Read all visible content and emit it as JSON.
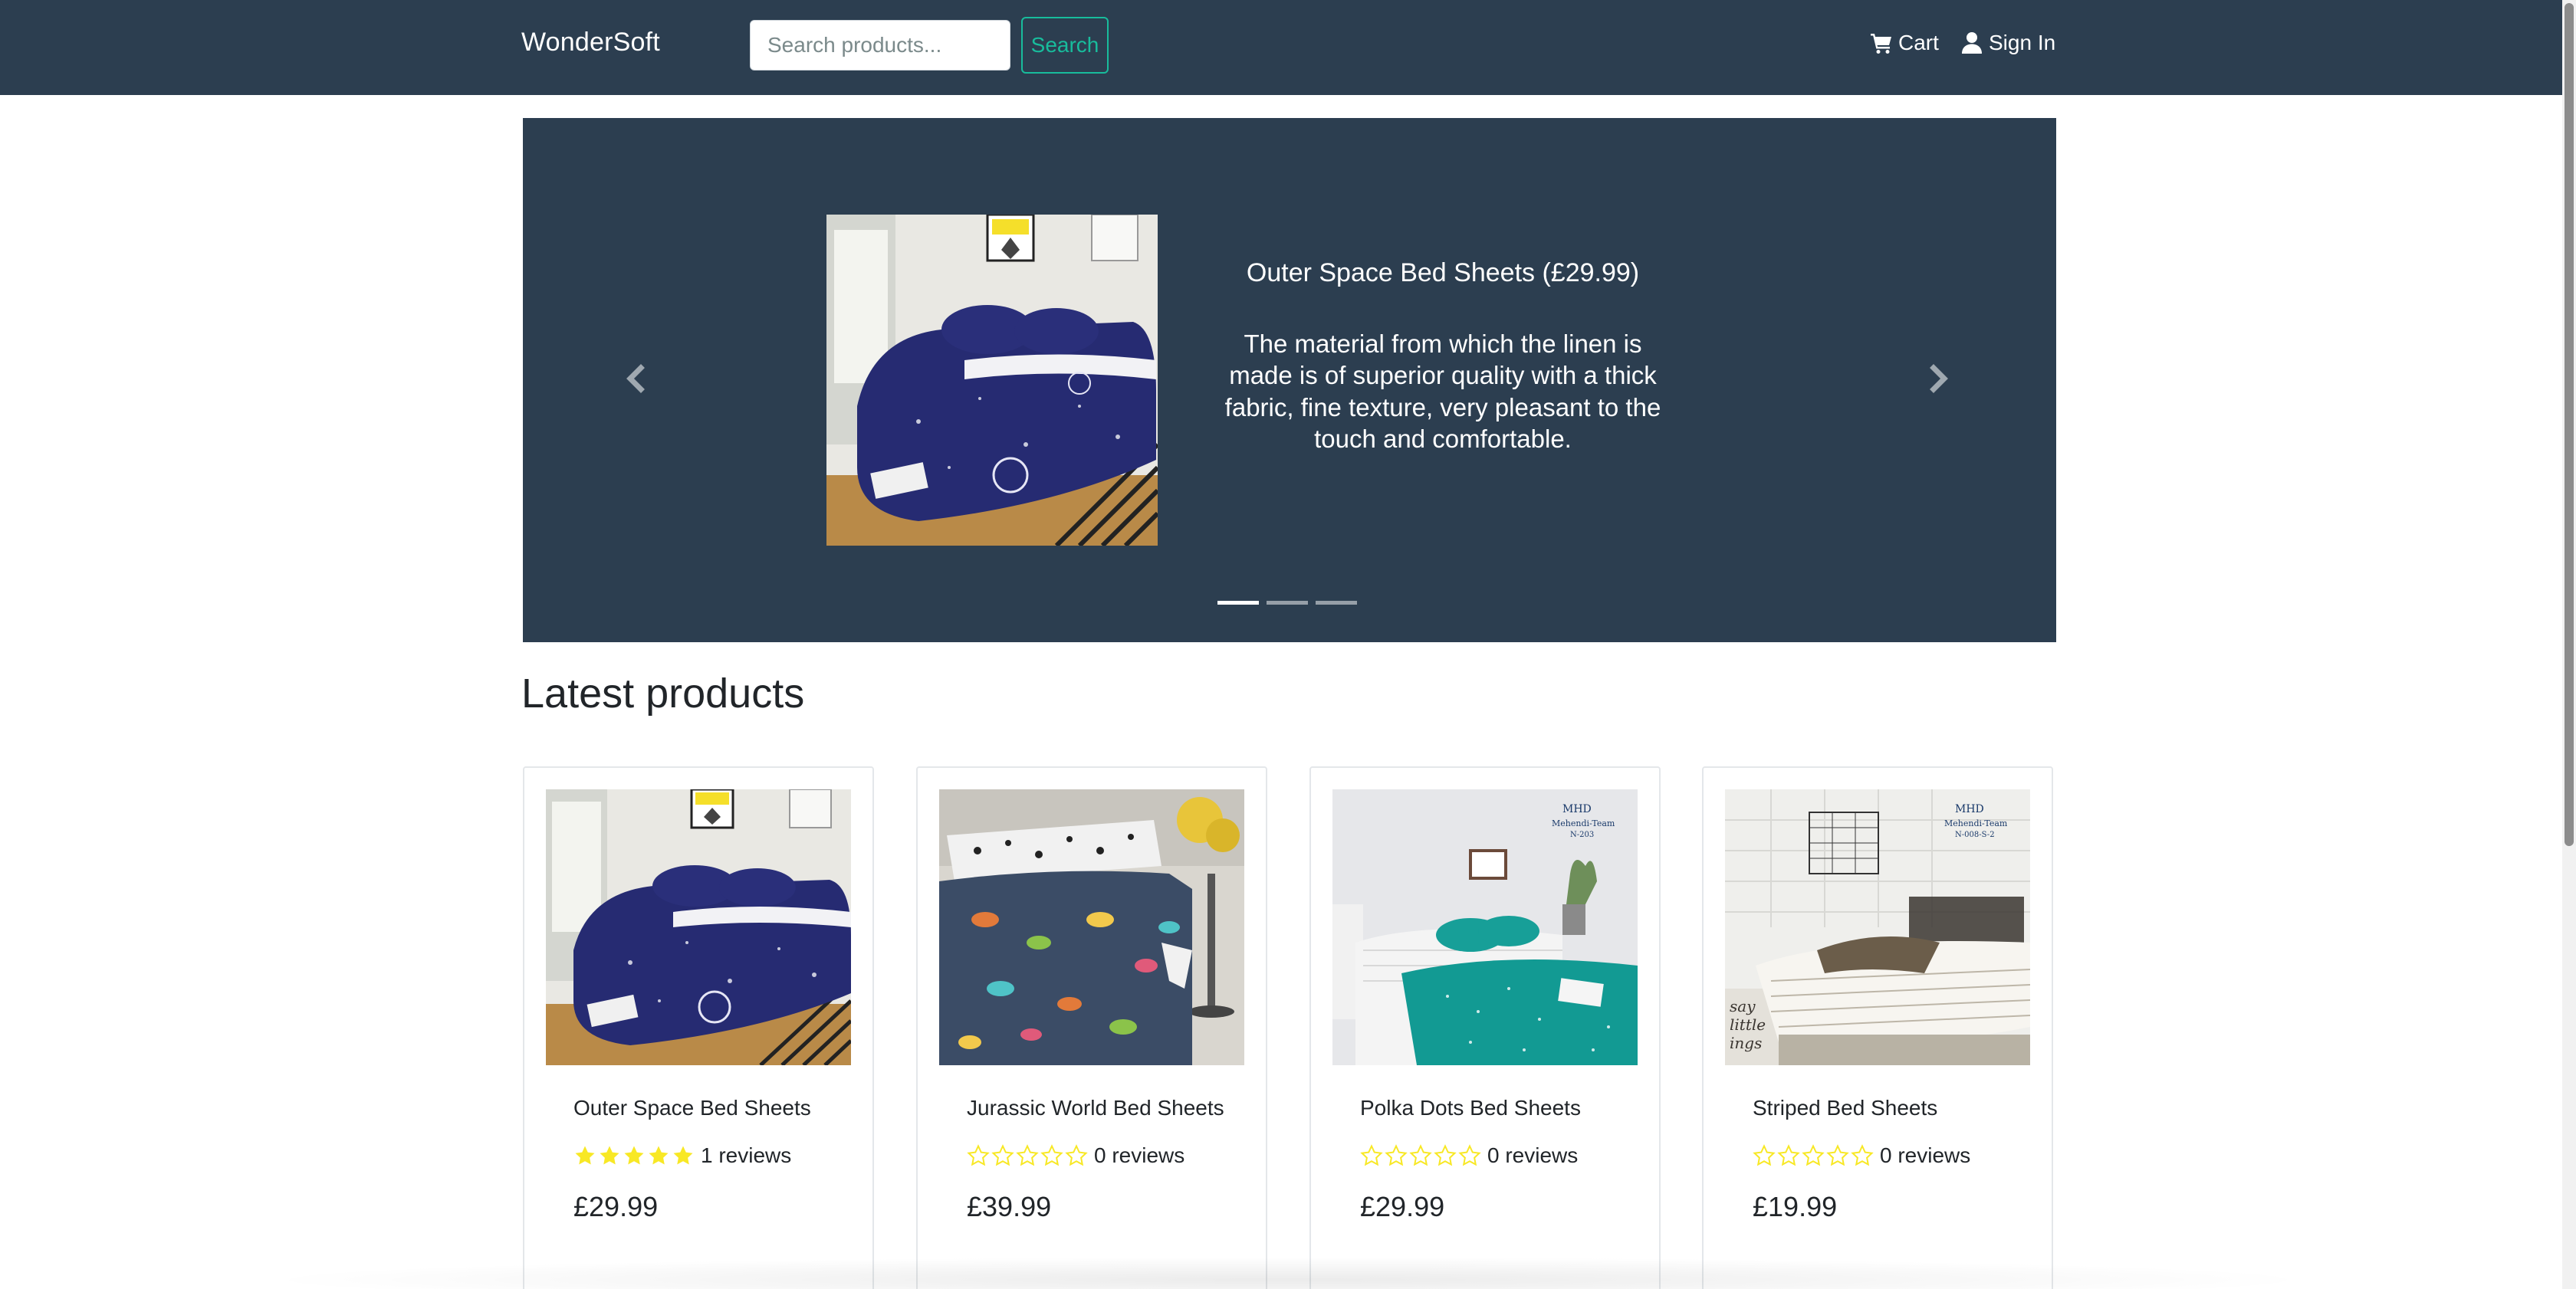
{
  "navbar": {
    "brand": "WonderSoft",
    "search": {
      "placeholder": "Search products...",
      "value": ""
    },
    "search_button": "Search",
    "cart_label": "Cart",
    "signin_label": "Sign In"
  },
  "carousel": {
    "title": "Outer Space Bed Sheets (£29.99)",
    "description": "The material from which the linen is made is of superior quality with a thick fabric, fine texture, very pleasant to the touch and comfortable.",
    "indicators": 3,
    "active_index": 0
  },
  "section_title": "Latest products",
  "products": [
    {
      "name": "Outer Space Bed Sheets",
      "rating": 5,
      "reviews": "1 reviews",
      "price": "£29.99",
      "image": "outer-space"
    },
    {
      "name": "Jurassic World Bed Sheets",
      "rating": 0,
      "reviews": "0 reviews",
      "price": "£39.99",
      "image": "jurassic"
    },
    {
      "name": "Polka Dots Bed Sheets",
      "rating": 0,
      "reviews": "0 reviews",
      "price": "£29.99",
      "image": "polka"
    },
    {
      "name": "Striped Bed Sheets",
      "rating": 0,
      "reviews": "0 reviews",
      "price": "£19.99",
      "image": "striped"
    }
  ],
  "colors": {
    "navbar_bg": "#2c3e50",
    "accent": "#18bc9c",
    "star": "#f8e825"
  },
  "icons": [
    "shopping-cart-icon",
    "user-icon",
    "chevron-left-icon",
    "chevron-right-icon",
    "star-icon"
  ]
}
